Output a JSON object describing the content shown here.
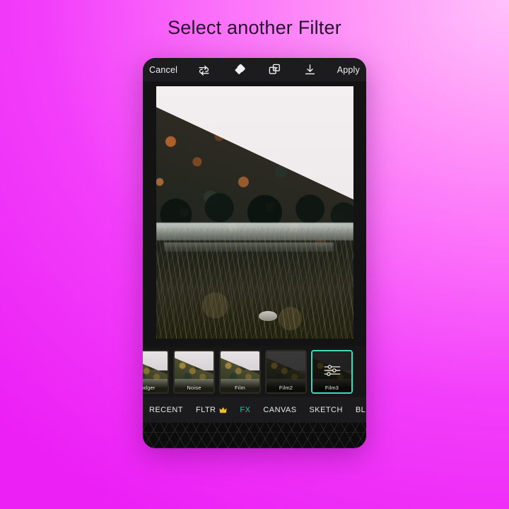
{
  "page": {
    "title": "Select another Filter",
    "background_start": "#ffc2fb",
    "background_end": "#ec1ff5"
  },
  "phone": {
    "toolbar": {
      "cancel_label": "Cancel",
      "apply_label": "Apply",
      "icons": [
        {
          "name": "redo-loop-icon"
        },
        {
          "name": "eraser-icon"
        },
        {
          "name": "layers-icon"
        },
        {
          "name": "download-icon"
        }
      ]
    },
    "photo": {
      "alt": "autumn forested hillside with overcast white sky, stream and dry brush"
    },
    "filters": {
      "selected": "Film3",
      "selected_border_color": "#45d6c0",
      "items": [
        {
          "label": "odger"
        },
        {
          "label": "Noise"
        },
        {
          "label": "Film"
        },
        {
          "label": "Film2"
        },
        {
          "label": "Film3"
        }
      ]
    },
    "tabs": {
      "active": "FX",
      "active_color": "#2fbf9d",
      "items": [
        {
          "label": "RECENT",
          "premium": false
        },
        {
          "label": "FLTR",
          "premium": true
        },
        {
          "label": "FX",
          "premium": false
        },
        {
          "label": "CANVAS",
          "premium": false
        },
        {
          "label": "SKETCH",
          "premium": false
        },
        {
          "label": "BL",
          "premium": false
        }
      ]
    }
  }
}
